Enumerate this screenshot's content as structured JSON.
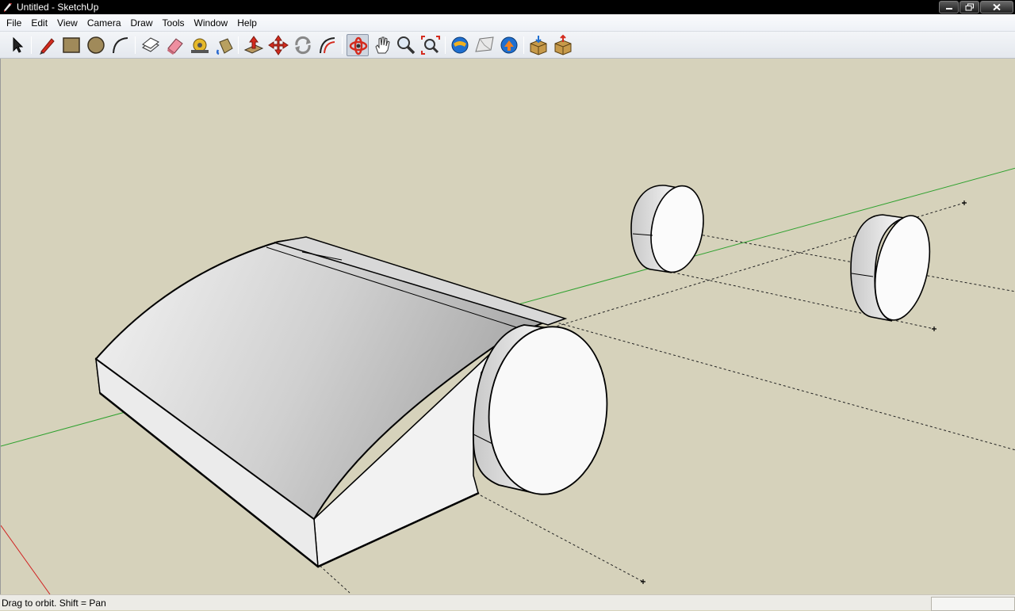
{
  "window": {
    "title": "Untitled - SketchUp"
  },
  "menu": {
    "items": [
      "File",
      "Edit",
      "View",
      "Camera",
      "Draw",
      "Tools",
      "Window",
      "Help"
    ]
  },
  "toolbar": {
    "tools": [
      {
        "name": "select-tool-icon",
        "title": "Select"
      },
      {
        "name": "line-tool-icon",
        "title": "Line"
      },
      {
        "name": "rectangle-tool-icon",
        "title": "Rectangle"
      },
      {
        "name": "circle-tool-icon",
        "title": "Circle"
      },
      {
        "name": "arc-tool-icon",
        "title": "Arc"
      },
      {
        "name": "make-component-icon",
        "title": "Make Component"
      },
      {
        "name": "eraser-tool-icon",
        "title": "Eraser"
      },
      {
        "name": "tape-measure-icon",
        "title": "Tape Measure"
      },
      {
        "name": "paint-bucket-icon",
        "title": "Paint Bucket"
      },
      {
        "name": "push-pull-icon",
        "title": "Push/Pull"
      },
      {
        "name": "move-tool-icon",
        "title": "Move"
      },
      {
        "name": "rotate-tool-icon",
        "title": "Rotate"
      },
      {
        "name": "offset-tool-icon",
        "title": "Offset"
      },
      {
        "name": "orbit-tool-icon",
        "title": "Orbit"
      },
      {
        "name": "pan-tool-icon",
        "title": "Pan"
      },
      {
        "name": "zoom-tool-icon",
        "title": "Zoom"
      },
      {
        "name": "zoom-extents-icon",
        "title": "Zoom Extents"
      },
      {
        "name": "get-location-icon",
        "title": "Get Current View"
      },
      {
        "name": "toggle-terrain-icon",
        "title": "Toggle Terrain"
      },
      {
        "name": "place-model-icon",
        "title": "Place Model"
      },
      {
        "name": "get-models-icon",
        "title": "Get Models"
      },
      {
        "name": "share-model-icon",
        "title": "Share Model"
      }
    ]
  },
  "status": {
    "text": "Drag to orbit.  Shift = Pan",
    "measurements": ""
  },
  "colors": {
    "background": "#d6d2bb",
    "green_axis": "#2ea12e",
    "red_axis": "#d02020",
    "edge": "#000000"
  }
}
